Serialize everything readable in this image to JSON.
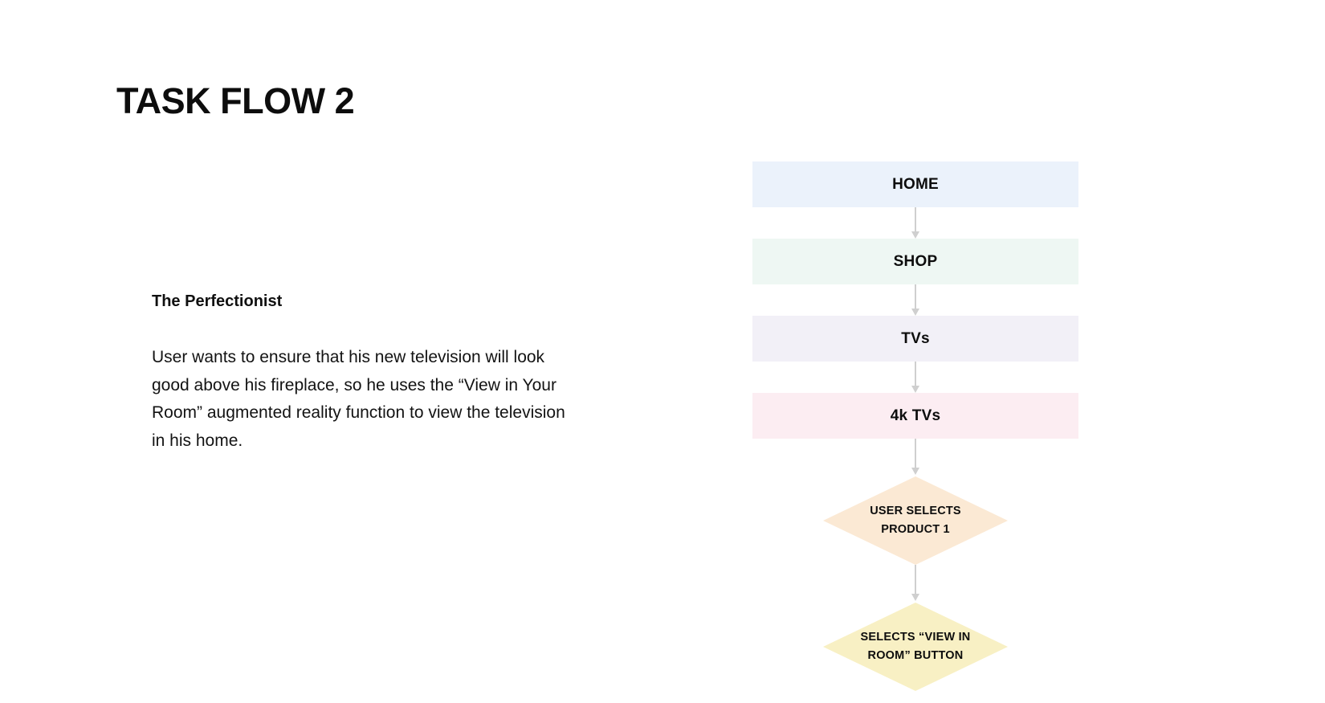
{
  "slide": {
    "title": "TASK FLOW 2",
    "background_color": "#ffffff"
  },
  "persona": {
    "heading": "The Perfectionist",
    "body": "User wants to ensure that his new television will look good above his fireplace, so he uses the “View in Your Room” augmented reality function to view the television in his home."
  },
  "flow": {
    "connector_color": "#cfcfcf",
    "nodes": [
      {
        "id": "home",
        "shape": "rectangle",
        "label": "HOME",
        "fill": "#ebf2fb"
      },
      {
        "id": "shop",
        "shape": "rectangle",
        "label": "SHOP",
        "fill": "#eef7f3"
      },
      {
        "id": "tvs",
        "shape": "rectangle",
        "label": "TVs",
        "fill": "#f2f0f7"
      },
      {
        "id": "4k-tvs",
        "shape": "rectangle",
        "label": "4k TVs",
        "fill": "#fcedf2"
      },
      {
        "id": "select-product",
        "shape": "diamond",
        "line1": "USER SELECTS",
        "line2": "PRODUCT 1",
        "fill": "#fbe9d4"
      },
      {
        "id": "select-view-in-room",
        "shape": "diamond",
        "line1": "SELECTS “VIEW IN",
        "line2": "ROOM” BUTTON",
        "fill": "#f8f0c4"
      }
    ]
  }
}
